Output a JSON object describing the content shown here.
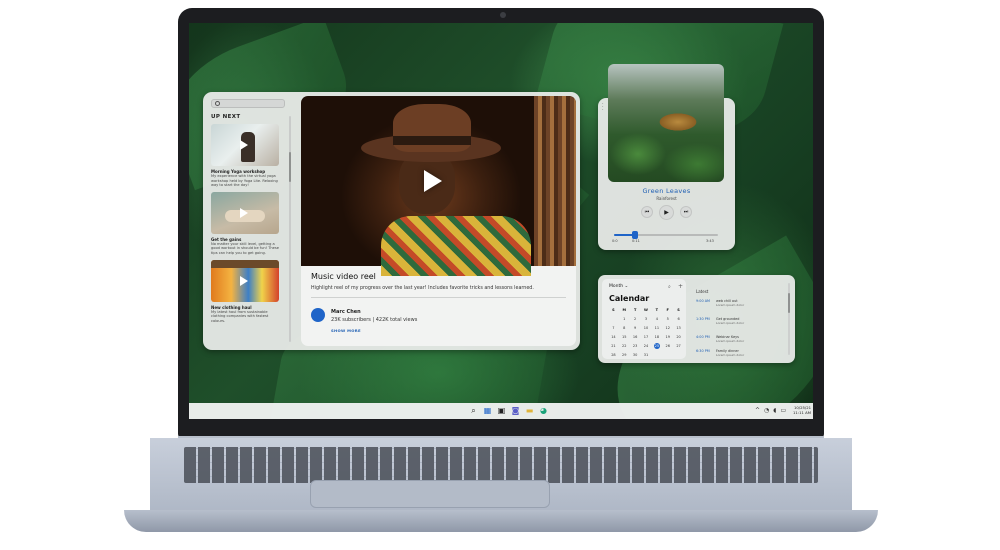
{
  "video_app": {
    "search_placeholder": "",
    "up_next_label": "UP NEXT",
    "up_next": [
      {
        "title": "Morning Yoga workshop",
        "desc": "My experience with the virtual yoga workshop held by Yoga Lite. Relaxing way to start the day!"
      },
      {
        "title": "Get the gains",
        "desc": "No matter your skill level, getting a good workout in should be fun! These tips can help you to get going."
      },
      {
        "title": "New clothing haul",
        "desc": "My latest haul from sustainable clothing companies with fastest colours."
      }
    ],
    "video": {
      "title": "Music video reel",
      "description": "Highlight reel of my progress over the last year! Includes favorite tricks and lessons learned.",
      "channel_name": "Marc Chen",
      "channel_stats": "23K subscribers | 422K total views",
      "show_more": "SHOW MORE"
    }
  },
  "music_widget": {
    "track_title": "Green Leaves",
    "artist": "Rainforest",
    "prev_symbol": "⏮",
    "play_symbol": "▶",
    "next_symbol": "⏭",
    "time_elapsed": "0:11",
    "time_start": "0:0",
    "time_total": "3:43",
    "progress": 0.2
  },
  "calendar": {
    "view_select": "Month ⌄",
    "search_symbol": "⌕",
    "add_symbol": "+",
    "title": "Calendar",
    "weekdays": [
      "S",
      "M",
      "T",
      "W",
      "T",
      "F",
      "S"
    ],
    "days": [
      "",
      "1",
      "2",
      "3",
      "4",
      "5",
      "6",
      "7",
      "8",
      "9",
      "10",
      "11",
      "12",
      "13",
      "14",
      "15",
      "16",
      "17",
      "18",
      "19",
      "20",
      "21",
      "22",
      "23",
      "24",
      "25",
      "26",
      "27",
      "28",
      "29",
      "30",
      "31",
      "",
      ""
    ],
    "today": "25",
    "agenda_label": "Latest",
    "agenda": [
      {
        "time": "9:00 AM",
        "text": "web chill out",
        "sub": "Lorem ipsum dolor"
      },
      {
        "time": "1:30 PM",
        "text": "Get grounded",
        "sub": "Lorem ipsum dolor"
      },
      {
        "time": "4:00 PM",
        "text": "Webinar Keys",
        "sub": "Lorem ipsum dolor"
      },
      {
        "time": "6:30 PM",
        "text": "Family dinner",
        "sub": "Lorem ipsum dolor"
      }
    ]
  },
  "taskbar": {
    "icons": [
      "windows-icon",
      "search-icon",
      "widgets-icon",
      "task-view-icon",
      "chat-icon",
      "file-explorer-icon",
      "edge-icon"
    ],
    "tray_chevron": "^",
    "tray_wifi": "◔",
    "tray_volume": "◖",
    "tray_battery": "▭",
    "clock_date": "10/25/21",
    "clock_time": "11:11 AM"
  },
  "colors": {
    "accent": "#1f64c8",
    "track_title": "#1f5fb3",
    "panel_bg": "#e8eae8",
    "wallpaper": "#1f4f2a"
  }
}
